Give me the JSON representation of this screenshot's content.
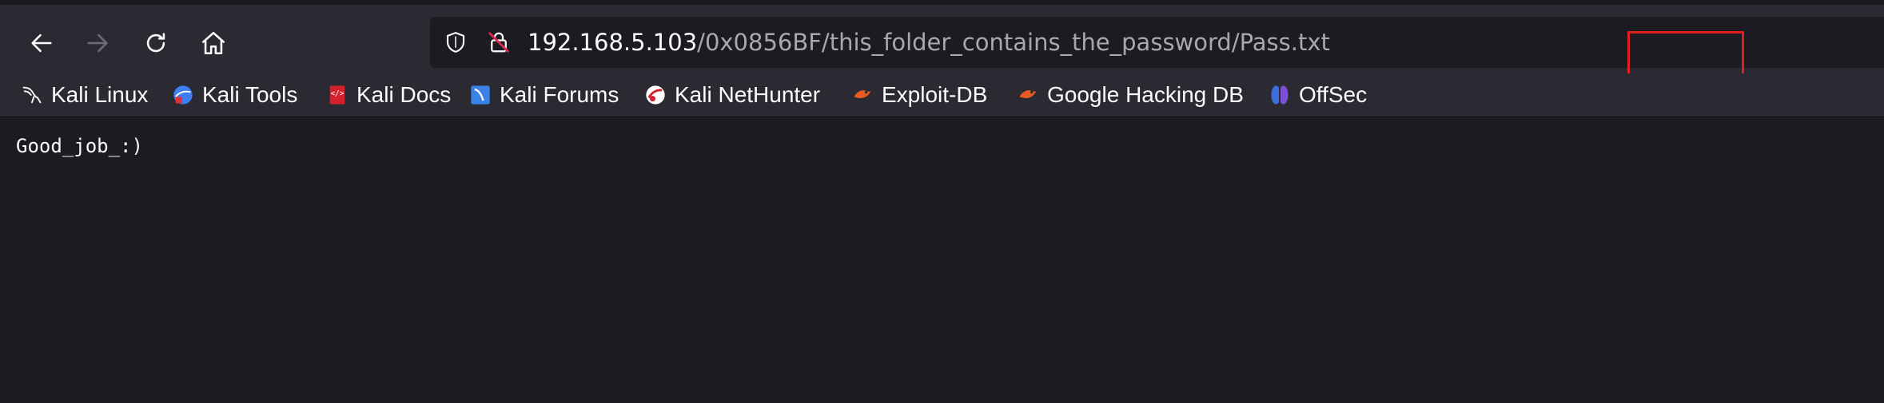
{
  "nav": {
    "back_icon": "arrow-left-icon",
    "forward_icon": "arrow-right-icon",
    "reload_icon": "reload-icon",
    "home_icon": "home-icon"
  },
  "urlbar": {
    "host": "192.168.5.103",
    "path": "/0x0856BF/this_folder_contains_the_password/Pass.txt",
    "shield_icon": "shield-icon",
    "insecure_lock_icon": "insecure-lock-icon",
    "highlight_color": "#e0201f"
  },
  "bookmarks": [
    {
      "label": "Kali Linux",
      "icon": "kali-dragon-icon"
    },
    {
      "label": "Kali Tools",
      "icon": "kali-tools-icon"
    },
    {
      "label": "Kali Docs",
      "icon": "kali-docs-icon"
    },
    {
      "label": "Kali Forums",
      "icon": "kali-forums-icon"
    },
    {
      "label": "Kali NetHunter",
      "icon": "nethunter-icon"
    },
    {
      "label": "Exploit-DB",
      "icon": "exploit-db-icon"
    },
    {
      "label": "Google Hacking DB",
      "icon": "ghdb-icon"
    },
    {
      "label": "OffSec",
      "icon": "offsec-icon"
    }
  ],
  "page": {
    "text": "Good_job_:)"
  },
  "colors": {
    "toolbar_bg": "#2b2a33",
    "content_bg": "#1c1b22",
    "text": "#fbfbfe",
    "dim_text": "#a8a8b0"
  }
}
